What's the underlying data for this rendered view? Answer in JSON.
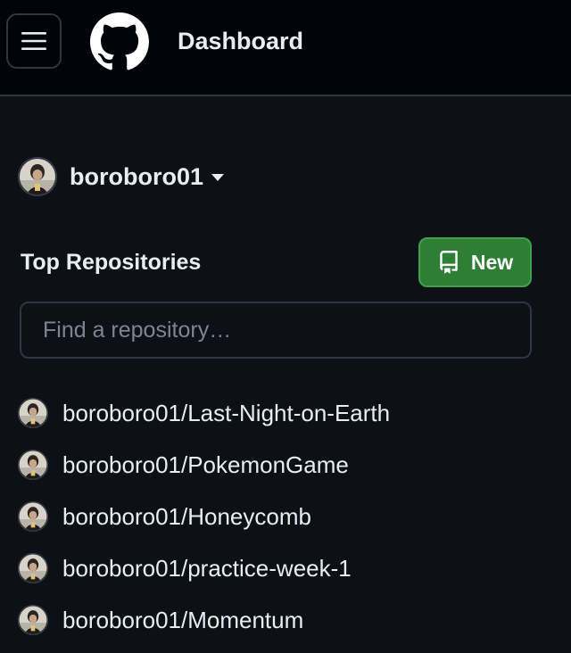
{
  "header": {
    "title": "Dashboard",
    "menu_icon": "hamburger-menu-icon",
    "logo_icon": "github-logo-icon"
  },
  "account": {
    "username": "boroboro01",
    "caret_icon": "caret-down-icon"
  },
  "repositories": {
    "title": "Top Repositories",
    "new_button_label": "New",
    "new_button_icon": "repo-icon",
    "search_placeholder": "Find a repository…",
    "items": [
      {
        "name": "boroboro01/Last-Night-on-Earth"
      },
      {
        "name": "boroboro01/PokemonGame"
      },
      {
        "name": "boroboro01/Honeycomb"
      },
      {
        "name": "boroboro01/practice-week-1"
      },
      {
        "name": "boroboro01/Momentum"
      }
    ]
  },
  "colors": {
    "background": "#0d1117",
    "header_background": "#010409",
    "border": "#30363d",
    "primary_button": "#2f7e36",
    "text": "#e6edf3",
    "muted_text": "#7d8590"
  }
}
